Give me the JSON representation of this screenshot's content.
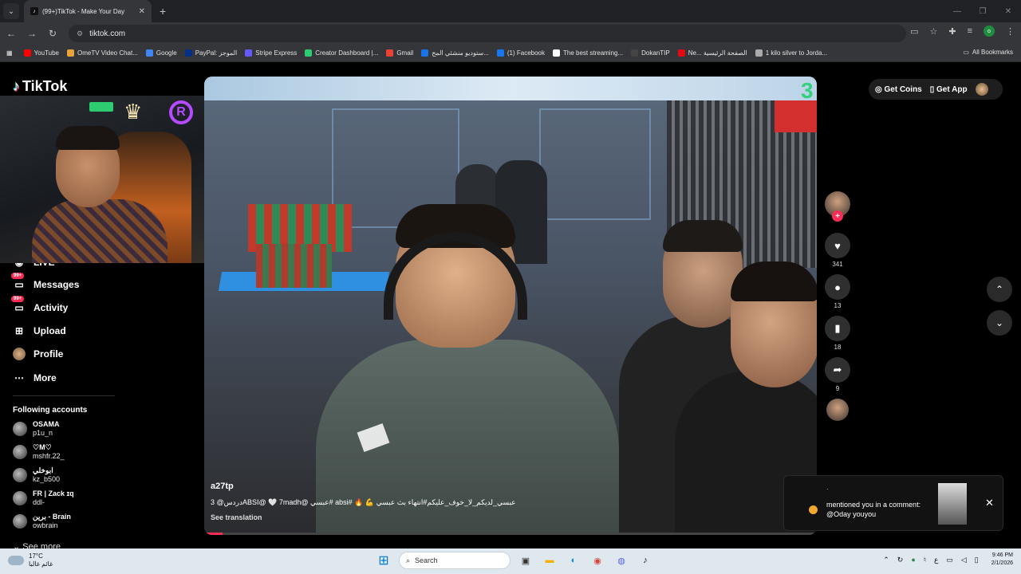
{
  "browser": {
    "tab_title": "(99+)TikTok - Make Your Day",
    "url": "tiktok.com",
    "profile_initial": "o",
    "bookmarks": [
      {
        "label": "YouTube",
        "color": "#ff0000"
      },
      {
        "label": "OmeTV Video Chat...",
        "color": "#e8a33d"
      },
      {
        "label": "Google",
        "color": "#4285f4"
      },
      {
        "label": "PayPal: الموجز",
        "color": "#003087"
      },
      {
        "label": "Stripe Express",
        "color": "#635bff"
      },
      {
        "label": "Creator Dashboard |...",
        "color": "#2ecc71"
      },
      {
        "label": "Gmail",
        "color": "#ea4335"
      },
      {
        "label": "ستوديو منشئي المح...",
        "color": "#1a73e8"
      },
      {
        "label": "(1) Facebook",
        "color": "#1877f2"
      },
      {
        "label": "The best streaming...",
        "color": "#ffffff"
      },
      {
        "label": "DokanTIP",
        "color": "#444444"
      },
      {
        "label": "Ne... الصفحة الرئيسية",
        "color": "#e50914"
      },
      {
        "label": "1 kilo silver to Jorda...",
        "color": "#aaaaaa"
      }
    ],
    "all_bookmarks": "All Bookmarks"
  },
  "tiktok": {
    "logo": "TikTok",
    "nav": {
      "live": "LIVE",
      "messages": "Messages",
      "activity": "Activity",
      "upload": "Upload",
      "profile": "Profile",
      "more": "More",
      "badge": "99+"
    },
    "following_header": "Following accounts",
    "following": [
      {
        "name": "OSAMA",
        "user": "p1u_n"
      },
      {
        "name": "♡M♡",
        "user": "mshfr.22_"
      },
      {
        "name": "ابوخلي",
        "user": "kz_b500"
      },
      {
        "name": "FR | Zack ɪq",
        "user": "ddl-"
      },
      {
        "name": "برين - Brain",
        "user": "owbrain"
      }
    ],
    "see_more": "See more",
    "top": {
      "get_coins": "Get Coins",
      "get_app": "Get App"
    },
    "video": {
      "username": "a27tp",
      "description": "دردس@ 3ABSI@ 🤍 7madh@ عبسي# absi# 🔥 💪 عبسي_لديكم_لا_خوف_عليكم#انتهاء بث عبسي",
      "see_translation": "See translation",
      "overlay_number": "3",
      "progress": 0.03
    },
    "actions": {
      "likes": "341",
      "comments": "13",
      "saves": "18",
      "shares": "9"
    },
    "toast": {
      "text": "mentioned you in a comment: @Oday youyou",
      "tick": "·"
    }
  },
  "taskbar": {
    "temp": "17°C",
    "weather": "غائم غالبا",
    "search": "Search",
    "lang": "ع",
    "time": "9:46 PM",
    "date": "2/1/2026"
  }
}
